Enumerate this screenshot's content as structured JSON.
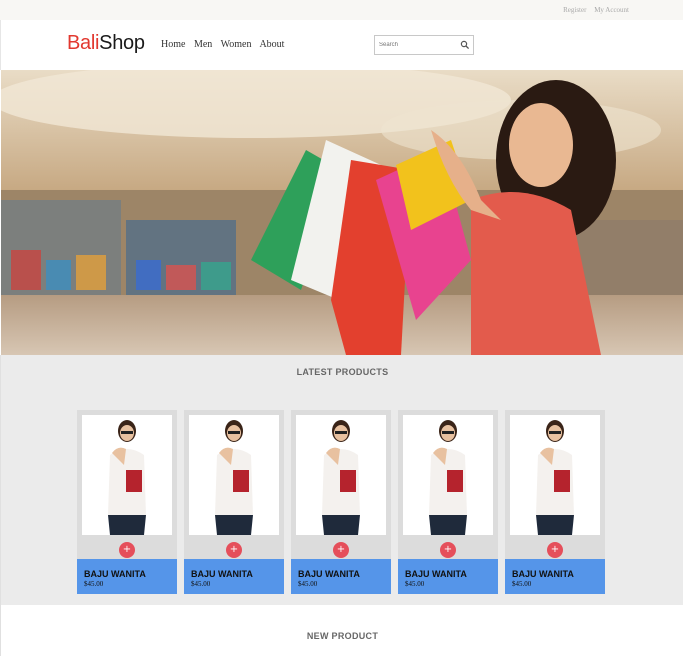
{
  "topbar": {
    "register": "Register",
    "account": "My Account"
  },
  "header": {
    "logo_part1": "Bali",
    "logo_part2": "Shop",
    "nav": [
      "Home",
      "Men",
      "Women",
      "About"
    ],
    "search_placeholder": "Search",
    "search_icon": "magnifier-icon"
  },
  "hero": {
    "image": "woman-with-shopping-bags-in-mall"
  },
  "latest": {
    "title": "LATEST PRODUCTS",
    "add_symbol": "+",
    "products": [
      {
        "name": "BAJU WANITA",
        "price": "$45.00"
      },
      {
        "name": "BAJU WANITA",
        "price": "$45.00"
      },
      {
        "name": "BAJU WANITA",
        "price": "$45.00"
      },
      {
        "name": "BAJU WANITA",
        "price": "$45.00"
      },
      {
        "name": "BAJU WANITA",
        "price": "$45.00"
      }
    ]
  },
  "new_product": {
    "title": "NEW PRODUCT"
  },
  "colors": {
    "brand_red": "#e2382f",
    "product_blue": "#5595e9",
    "add_button": "#e54f5b"
  }
}
